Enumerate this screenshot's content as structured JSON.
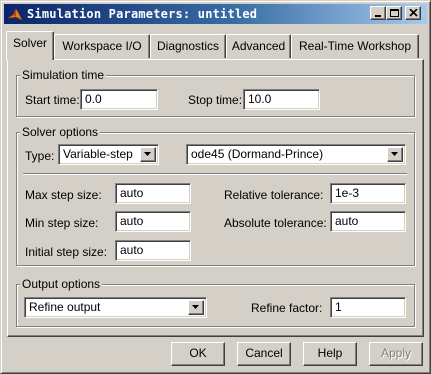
{
  "window": {
    "title": "Simulation Parameters: untitled",
    "icon": "matlab-logo-icon"
  },
  "caption_buttons": [
    "minimize",
    "maximize",
    "close"
  ],
  "tabs": [
    {
      "label": "Solver",
      "active": true
    },
    {
      "label": "Workspace I/O",
      "active": false
    },
    {
      "label": "Diagnostics",
      "active": false
    },
    {
      "label": "Advanced",
      "active": false
    },
    {
      "label": "Real-Time Workshop",
      "active": false
    }
  ],
  "simulation_time": {
    "group_label": "Simulation time",
    "start_label": "Start time:",
    "start_value": "0.0",
    "stop_label": "Stop time:",
    "stop_value": "10.0"
  },
  "solver_options": {
    "group_label": "Solver options",
    "type_label": "Type:",
    "type_value": "Variable-step",
    "solver_value": "ode45 (Dormand-Prince)",
    "max_step_label": "Max step size:",
    "max_step_value": "auto",
    "min_step_label": "Min step size:",
    "min_step_value": "auto",
    "initial_step_label": "Initial step size:",
    "initial_step_value": "auto",
    "rel_tol_label": "Relative tolerance:",
    "rel_tol_value": "1e-3",
    "abs_tol_label": "Absolute tolerance:",
    "abs_tol_value": "auto"
  },
  "output_options": {
    "group_label": "Output options",
    "output_value": "Refine output",
    "refine_label": "Refine factor:",
    "refine_value": "1"
  },
  "buttons": {
    "ok": "OK",
    "cancel": "Cancel",
    "help": "Help",
    "apply": "Apply",
    "apply_enabled": false
  },
  "colors": {
    "face": "#d4d0c8",
    "title_start": "#0a246a",
    "title_end": "#a6caf0"
  }
}
